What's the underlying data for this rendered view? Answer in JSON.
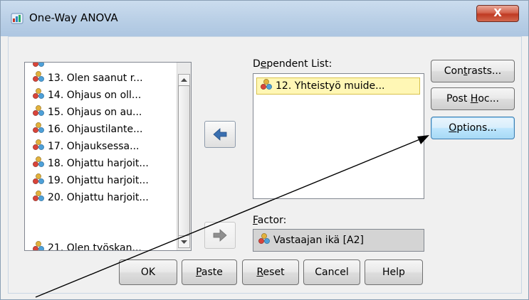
{
  "window": {
    "title": "One-Way ANOVA",
    "close_label": "X"
  },
  "variable_list": {
    "items": [
      {
        "label": "13. Olen saanut r...",
        "icon": "nominal-variable-icon"
      },
      {
        "label": "14. Ohjaus on oll...",
        "icon": "nominal-variable-icon"
      },
      {
        "label": "15. Ohjaus on au...",
        "icon": "nominal-variable-icon"
      },
      {
        "label": "16. Ohjaustilante...",
        "icon": "nominal-variable-icon"
      },
      {
        "label": "17. Ohjauksessa...",
        "icon": "nominal-variable-icon"
      },
      {
        "label": "18. Ohjattu harjoit...",
        "icon": "nominal-variable-icon"
      },
      {
        "label": "19. Ohjattu harjoit...",
        "icon": "nominal-variable-icon"
      },
      {
        "label": "20. Ohjattu harjoit...",
        "icon": "nominal-variable-icon"
      },
      {
        "label": "21. Olen työskan...",
        "icon": "nominal-variable-icon"
      }
    ]
  },
  "dependent_list": {
    "label_pre": "D",
    "label_ul": "e",
    "label_post": "pendent List:",
    "items": [
      {
        "label": "12. Yhteistyö muide..."
      }
    ]
  },
  "factor": {
    "label_pre": "",
    "label_ul": "F",
    "label_post": "actor:",
    "value": "Vastaajan ikä [A2]"
  },
  "side_buttons": {
    "contrasts": {
      "pre": "Con",
      "ul": "t",
      "post": "rasts..."
    },
    "post_hoc": {
      "pre": "Post ",
      "ul": "H",
      "post": "oc..."
    },
    "options": {
      "pre": "",
      "ul": "O",
      "post": "ptions..."
    }
  },
  "bottom_buttons": {
    "ok": {
      "pre": "OK",
      "ul": "",
      "post": ""
    },
    "paste": {
      "pre": "",
      "ul": "P",
      "post": "aste"
    },
    "reset": {
      "pre": "",
      "ul": "R",
      "post": "eset"
    },
    "cancel": {
      "pre": "Cancel",
      "ul": "",
      "post": ""
    },
    "help": {
      "pre": "Help",
      "ul": "",
      "post": ""
    }
  },
  "colors": {
    "selected_item_bg": "#fff7b5",
    "move_arrow": "#3a6fb0",
    "focus_button": "#bee6fd",
    "close_button": "#c7402a"
  }
}
